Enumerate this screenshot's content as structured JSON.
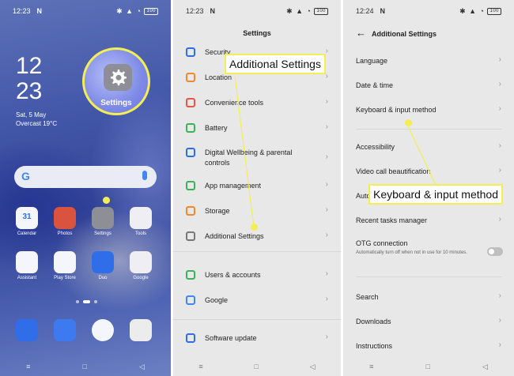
{
  "panel1": {
    "status_time": "12:23",
    "status_carrier": "N",
    "battery": "100",
    "clock_hour": "12",
    "clock_min": "23",
    "date": "Sat, 5 May",
    "weather": "Overcast 19°C",
    "highlight_label": "Settings",
    "search_g": "G",
    "apps": [
      {
        "name": "Calendar",
        "badge": "31",
        "color": "#f4f6fb"
      },
      {
        "name": "Photos",
        "color": "#d9533f"
      },
      {
        "name": "Settings",
        "color": "#8e8e96"
      },
      {
        "name": "Tools",
        "color": "#efeff3"
      },
      {
        "name": "Assistant",
        "color": "#f4f6fb"
      },
      {
        "name": "Play Store",
        "color": "#f4f6fb"
      },
      {
        "name": "Duo",
        "color": "#2f6ee8"
      },
      {
        "name": "Google",
        "color": "#efeff3"
      }
    ],
    "dock_colors": [
      "#2f6ee8",
      "#3d7af0",
      "#f4f6fb",
      "#ececec"
    ]
  },
  "panel2": {
    "status_time": "12:23",
    "status_carrier": "N",
    "battery": "100",
    "title": "Settings",
    "items": [
      {
        "label": "Security",
        "icon_color": "#2f6ee8"
      },
      {
        "label": "Location",
        "icon_color": "#f08a2b"
      },
      {
        "label": "Convenience tools",
        "icon_color": "#e8564a"
      },
      {
        "label": "Battery",
        "icon_color": "#3cb35a"
      },
      {
        "label": "Digital Wellbeing & parental",
        "label2": "controls",
        "icon_color": "#2f6ee8"
      },
      {
        "label": "App management",
        "icon_color": "#3cb35a"
      },
      {
        "label": "Storage",
        "icon_color": "#f08a2b"
      },
      {
        "label": "Additional Settings",
        "icon_color": "#777777"
      },
      {
        "label": "Users & accounts",
        "icon_color": "#3cb35a"
      },
      {
        "label": "Google",
        "icon_color": "#4285f4"
      },
      {
        "label": "Software update",
        "icon_color": "#2f6ee8"
      }
    ],
    "callout": "Additional Settings"
  },
  "panel3": {
    "status_time": "12:24",
    "status_carrier": "N",
    "battery": "100",
    "back_arrow": "←",
    "title": "Additional Settings",
    "items": [
      {
        "label": "Language"
      },
      {
        "label": "Date & time"
      },
      {
        "label": "Keyboard & input method"
      },
      {
        "label": "Accessibility"
      },
      {
        "label": "Video call beautification"
      },
      {
        "label": "Auto"
      },
      {
        "label": "Recent tasks manager"
      },
      {
        "label": "OTG connection",
        "sub": "Automatically turn off when not in use for 10 minutes."
      },
      {
        "label": "Search"
      },
      {
        "label": "Downloads"
      },
      {
        "label": "Instructions"
      }
    ],
    "callout": "Keyboard & input method"
  },
  "nav": {
    "menu": "≡",
    "home": "□",
    "back": "◁"
  },
  "chevron": "›",
  "colors": {
    "highlight": "#f3ee55",
    "panel_bg": "#e8e8e8"
  }
}
